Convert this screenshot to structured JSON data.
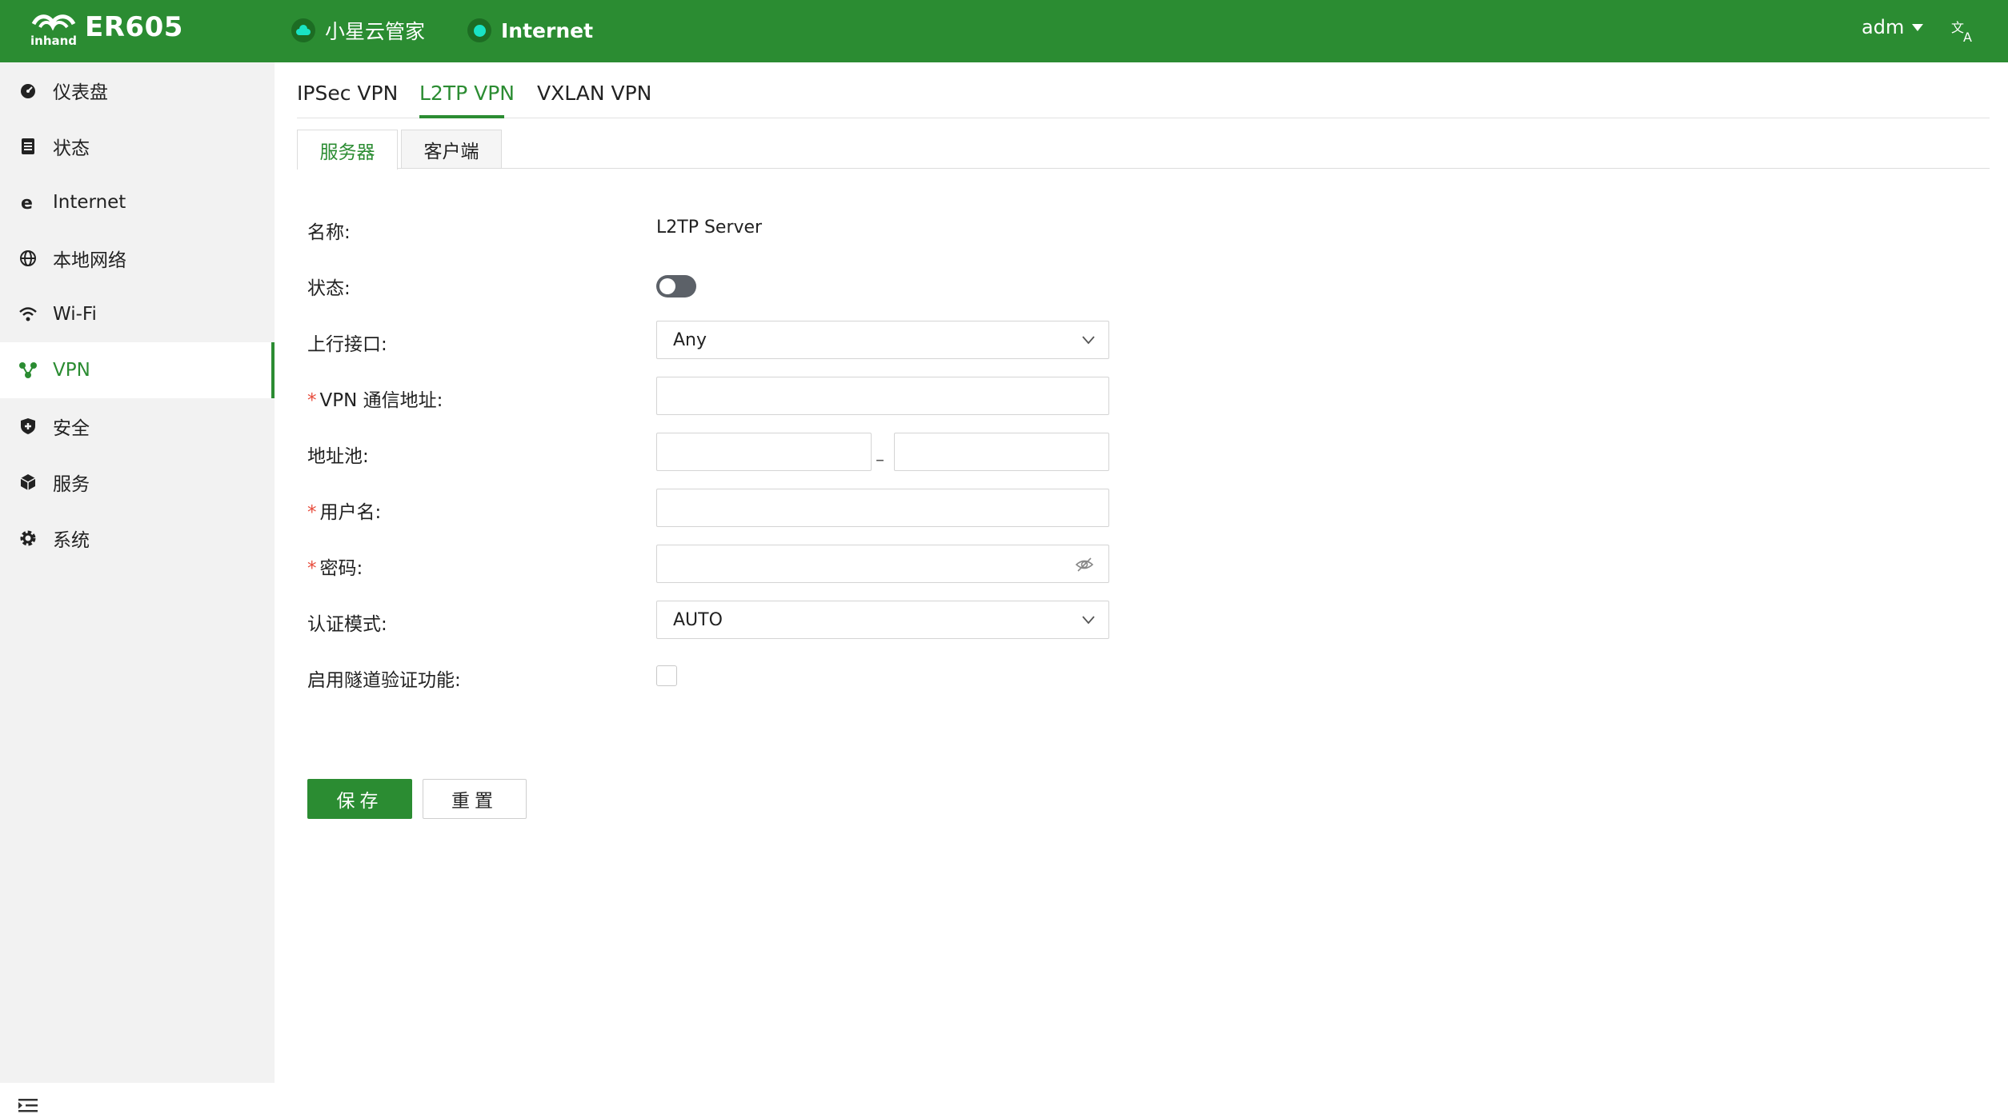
{
  "header": {
    "product": "ER605",
    "cloud_label": "小星云管家",
    "internet_label": "Internet",
    "user": "adm"
  },
  "sidebar": {
    "items": [
      {
        "label": "仪表盘",
        "icon": "dashboard-icon"
      },
      {
        "label": "状态",
        "icon": "status-icon"
      },
      {
        "label": "Internet",
        "icon": "internet-icon"
      },
      {
        "label": "本地网络",
        "icon": "globe-icon"
      },
      {
        "label": "Wi-Fi",
        "icon": "wifi-icon"
      },
      {
        "label": "VPN",
        "icon": "vpn-icon",
        "active": true
      },
      {
        "label": "安全",
        "icon": "shield-icon"
      },
      {
        "label": "服务",
        "icon": "cube-icon"
      },
      {
        "label": "系统",
        "icon": "gear-icon"
      }
    ]
  },
  "vpn_tabs": [
    "IPSec VPN",
    "L2TP VPN",
    "VXLAN VPN"
  ],
  "vpn_tab_active": "L2TP VPN",
  "mode_tabs": [
    "服务器",
    "客户端"
  ],
  "mode_tab_active": "服务器",
  "form": {
    "name_label": "名称:",
    "name_value": "L2TP Server",
    "status_label": "状态:",
    "status_enabled": false,
    "uplink_label": "上行接口:",
    "uplink_value": "Any",
    "vpn_addr_label": "VPN 通信地址:",
    "vpn_addr_value": "",
    "pool_label": "地址池:",
    "pool_start": "",
    "pool_end": "",
    "pool_separator": "–",
    "username_label": "用户名:",
    "username_value": "",
    "password_label": "密码:",
    "password_value": "",
    "auth_label": "认证模式:",
    "auth_value": "AUTO",
    "tunnel_auth_label": "启用隧道验证功能:",
    "tunnel_auth_checked": false,
    "required_mark": "*"
  },
  "buttons": {
    "save": "保存",
    "reset": "重置"
  },
  "colors": {
    "brand": "#2b8c32",
    "internet_dot": "#19e3c4",
    "required": "#e74c3c"
  }
}
